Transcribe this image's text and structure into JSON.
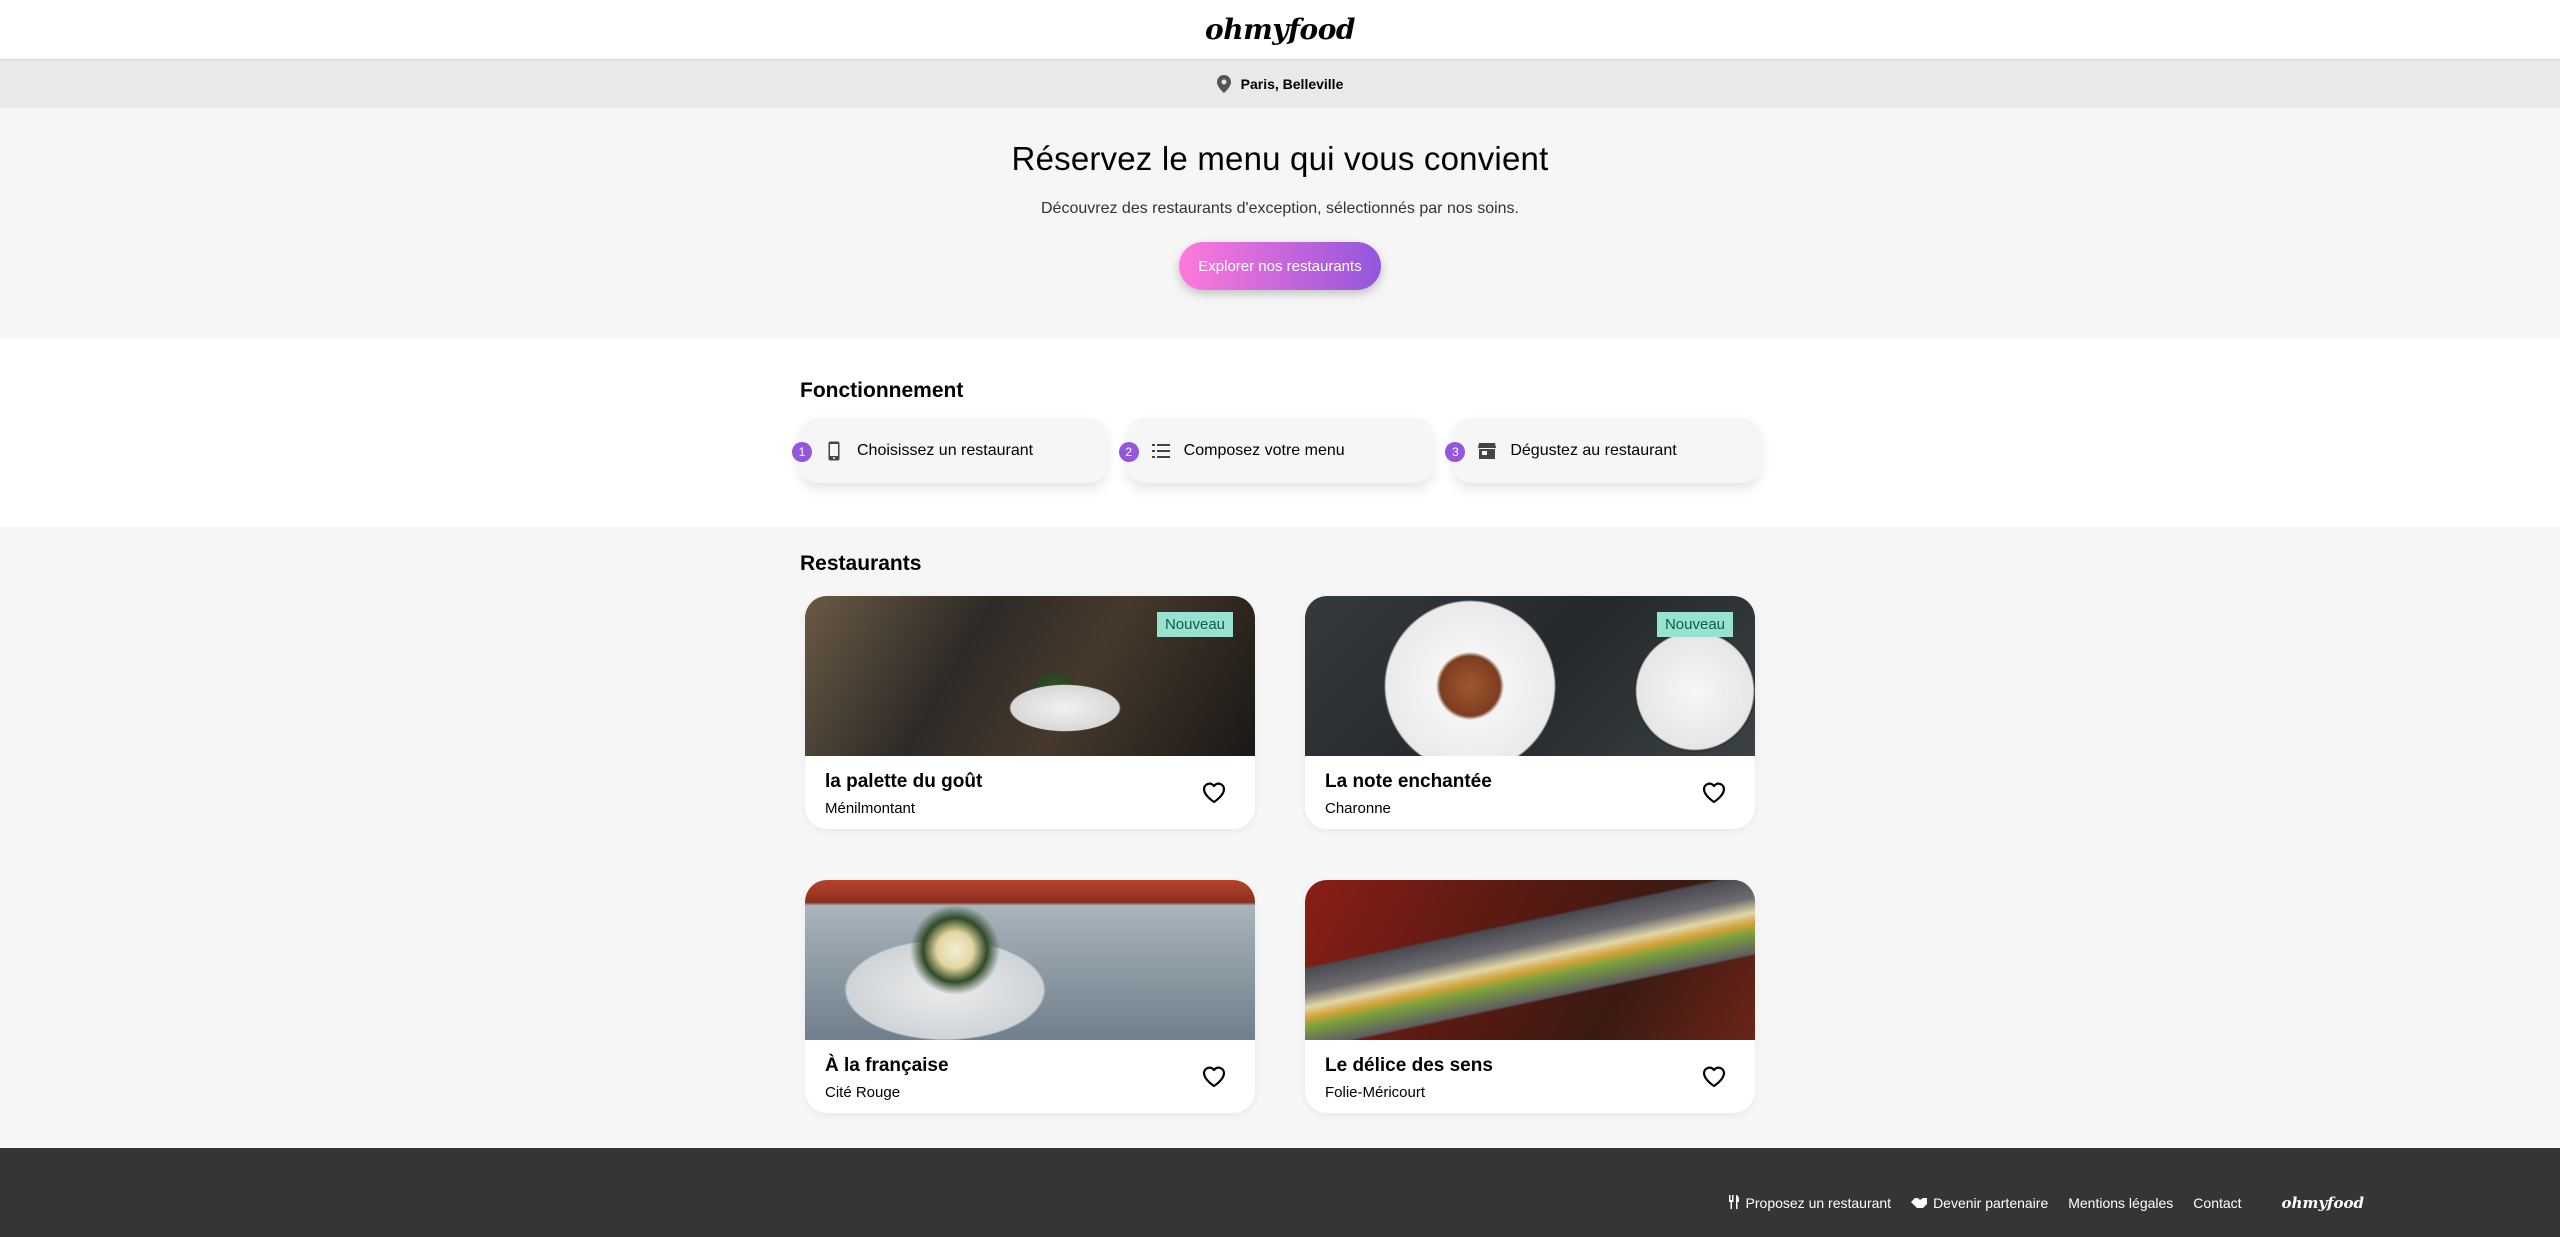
{
  "header": {
    "logo": "ohmyfood",
    "location": "Paris, Belleville"
  },
  "hero": {
    "title": "Réservez le menu qui vous convient",
    "subtitle": "Découvrez des restaurants d'exception, sélectionnés par nos soins.",
    "cta_label": "Explorer nos restaurants"
  },
  "how": {
    "title": "Fonctionnement",
    "steps": [
      {
        "num": "1",
        "icon": "mobile-phone-icon",
        "label": "Choisissez un restaurant"
      },
      {
        "num": "2",
        "icon": "list-icon",
        "label": "Composez votre menu"
      },
      {
        "num": "3",
        "icon": "store-icon",
        "label": "Dégustez au restaurant"
      }
    ]
  },
  "restaurants": {
    "title": "Restaurants",
    "items": [
      {
        "name": "la palette du goût",
        "area": "Ménilmontant",
        "badge": "Nouveau"
      },
      {
        "name": "La note enchantée",
        "area": "Charonne",
        "badge": "Nouveau"
      },
      {
        "name": "À la française",
        "area": "Cité Rouge"
      },
      {
        "name": "Le délice des sens",
        "area": "Folie-Méricourt"
      }
    ]
  },
  "footer": {
    "links": [
      {
        "icon": "utensils-icon",
        "label": "Proposez un restaurant"
      },
      {
        "icon": "handshake-icon",
        "label": "Devenir partenaire"
      },
      {
        "label": "Mentions légales"
      },
      {
        "label": "Contact"
      }
    ],
    "logo": "ohmyfood"
  },
  "colors": {
    "accent_pink": "#ff79da",
    "accent_purple": "#9356dc",
    "badge_bg": "#99e2d0",
    "footer_bg": "#353535"
  }
}
